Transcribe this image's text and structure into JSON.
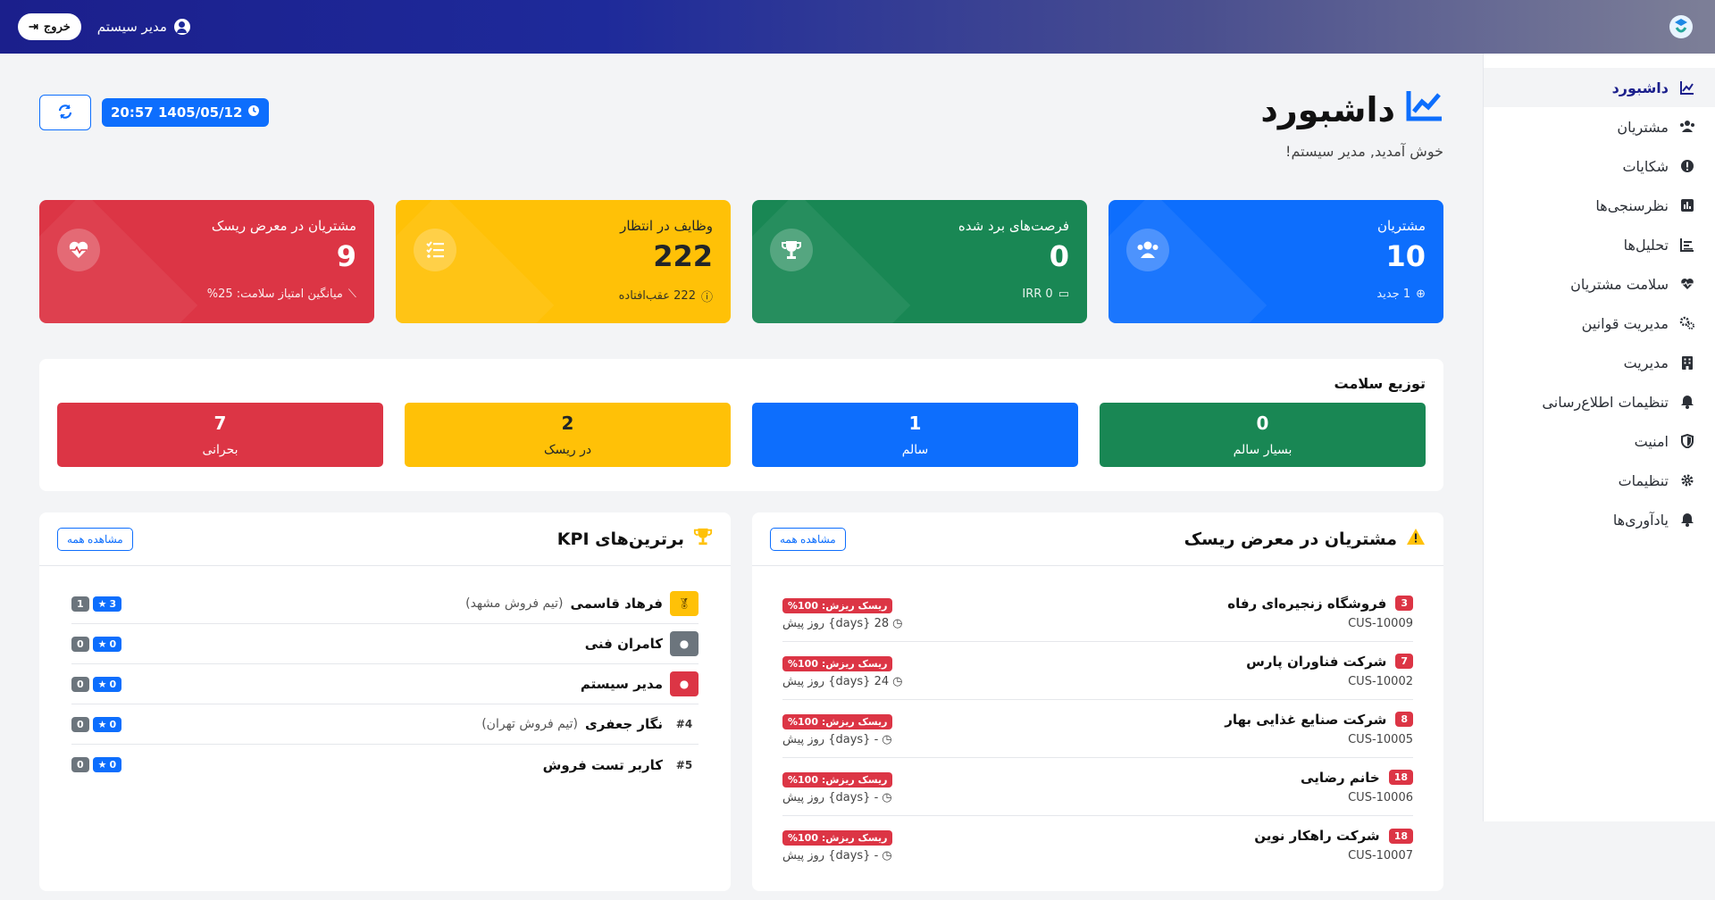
{
  "header": {
    "logout_label": "خروج",
    "user_name": "مدیر سیستم",
    "colors": {
      "gradient_start": "#1b1f8c",
      "gradient_end": "#7d7f97"
    }
  },
  "sidebar": {
    "items": [
      {
        "label": "داشبورد",
        "icon": "chart-line-icon",
        "active": true
      },
      {
        "label": "مشتریان",
        "icon": "users-icon",
        "active": false
      },
      {
        "label": "شکایات",
        "icon": "alert-circle-icon",
        "active": false
      },
      {
        "label": "نظرسنجی‌ها",
        "icon": "poll-icon",
        "active": false
      },
      {
        "label": "تحلیل‌ها",
        "icon": "analytics-icon",
        "active": false
      },
      {
        "label": "سلامت مشتریان",
        "icon": "heartbeat-icon",
        "active": false
      },
      {
        "label": "مدیریت قوانین",
        "icon": "gears-icon",
        "active": false
      },
      {
        "label": "مدیریت",
        "icon": "building-icon",
        "active": false
      },
      {
        "label": "تنظیمات اطلاع‌رسانی",
        "icon": "bell-icon",
        "active": false
      },
      {
        "label": "امنیت",
        "icon": "shield-icon",
        "active": false
      },
      {
        "label": "تنظیمات",
        "icon": "gear-icon",
        "active": false
      },
      {
        "label": "یادآوری‌ها",
        "icon": "bell-icon",
        "active": false
      }
    ]
  },
  "page": {
    "title": "داشبورد",
    "welcome": "خوش آمدید, مدیر سیستم!",
    "datetime": "20:57 1405/05/12"
  },
  "stats": [
    {
      "title": "مشتریان",
      "value": "10",
      "foot": "1 جدید",
      "icon": "users-icon",
      "color": "#0d6efd"
    },
    {
      "title": "فرصت‌های برد شده",
      "value": "0",
      "foot": "IRR 0",
      "icon": "trophy-icon",
      "color": "#198754"
    },
    {
      "title": "وظایف در انتظار",
      "value": "222",
      "foot": "222 عقب‌افتاده",
      "icon": "tasks-icon",
      "color": "#ffc107"
    },
    {
      "title": "مشتریان در معرض ریسک",
      "value": "9",
      "foot": "میانگین امتیاز سلامت: 25%",
      "icon": "heart-pulse-icon",
      "color": "#dc3545"
    }
  ],
  "health": {
    "title": "توزیع سلامت",
    "boxes": [
      {
        "value": "0",
        "label": "بسیار سالم",
        "color": "#198754"
      },
      {
        "value": "1",
        "label": "سالم",
        "color": "#0d6efd"
      },
      {
        "value": "2",
        "label": "در ریسک",
        "color": "#ffc107"
      },
      {
        "value": "7",
        "label": "بحرانی",
        "color": "#dc3545"
      }
    ]
  },
  "risk_panel": {
    "title": "مشتریان در معرض ریسک",
    "view_all": "مشاهده همه",
    "items": [
      {
        "name": "فروشگاه زنجیره‌ای رفاه",
        "count": "3",
        "code": "CUS-10009",
        "risk": "ریسک ریزش: 100%",
        "when": "28 {days} روز پیش"
      },
      {
        "name": "شرکت فناوران پارس",
        "count": "7",
        "code": "CUS-10002",
        "risk": "ریسک ریزش: 100%",
        "when": "24 {days} روز پیش"
      },
      {
        "name": "شرکت صنایع غذایی بهار",
        "count": "8",
        "code": "CUS-10005",
        "risk": "ریسک ریزش: 100%",
        "when": "- {days} روز پیش"
      },
      {
        "name": "خانم رضایی",
        "count": "18",
        "code": "CUS-10006",
        "risk": "ریسک ریزش: 100%",
        "when": "- {days} روز پیش"
      },
      {
        "name": "شرکت راهکار نوین",
        "count": "18",
        "code": "CUS-10007",
        "risk": "ریسک ریزش: 100%",
        "when": "- {days} روز پیش"
      }
    ]
  },
  "kpi_panel": {
    "title": "برترین‌های KPI",
    "view_all": "مشاهده همه",
    "items": [
      {
        "rank_label": "",
        "medal": "gold-medal-icon",
        "name": "فرهاد قاسمی",
        "team": "(تیم فروش مشهد)",
        "stars": "3",
        "count": "1"
      },
      {
        "rank_label": "",
        "medal": "silver-medal-icon",
        "name": "کامران فنی",
        "team": "",
        "stars": "0",
        "count": "0"
      },
      {
        "rank_label": "",
        "medal": "bronze-medal-icon",
        "name": "مدیر سیستم",
        "team": "",
        "stars": "0",
        "count": "0"
      },
      {
        "rank_label": "#4",
        "medal": "",
        "name": "نگار جعفری",
        "team": "(تیم فروش تهران)",
        "stars": "0",
        "count": "0"
      },
      {
        "rank_label": "#5",
        "medal": "",
        "name": "کاربر تست فروش",
        "team": "",
        "stars": "0",
        "count": "0"
      }
    ]
  }
}
